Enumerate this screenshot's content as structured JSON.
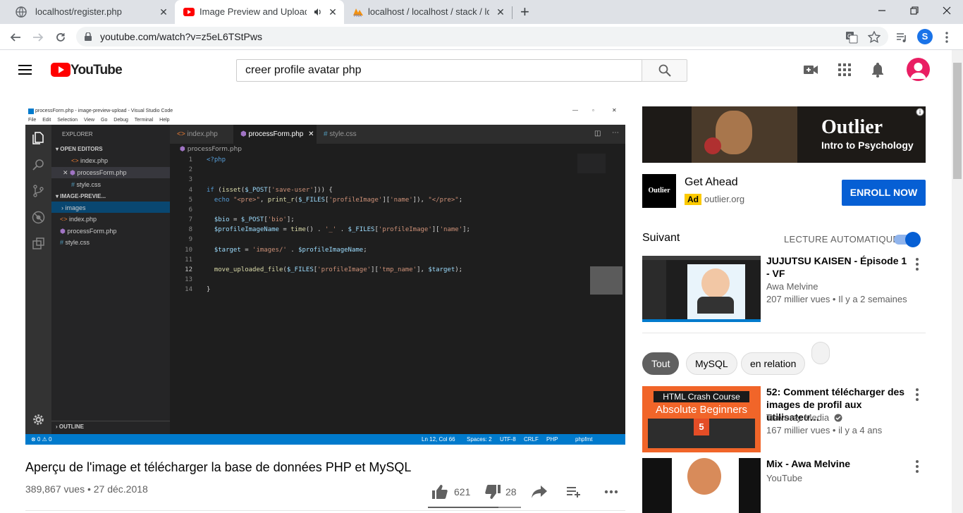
{
  "browser": {
    "tabs": [
      {
        "title": "localhost/register.php",
        "favicon": "globe-icon"
      },
      {
        "title": "Image Preview and Upload P",
        "favicon": "youtube-icon",
        "active": true,
        "audio": "speaker-icon"
      },
      {
        "title": "localhost / localhost / stack / log",
        "favicon": "phpmyadmin-icon"
      }
    ],
    "new_tab": "+",
    "url": "youtube.com/watch?v=z5eL6TStPws",
    "profile_initial": "S"
  },
  "youtube": {
    "logo_text": "YouTube",
    "search_value": "creer profile avatar php"
  },
  "player": {
    "vs_title": "processForm.php - image-preview-upload - Visual Studio Code",
    "vs_menu": [
      "File",
      "Edit",
      "Selection",
      "View",
      "Go",
      "Debug",
      "Terminal",
      "Help"
    ],
    "explorer_label": "EXPLORER",
    "open_editors_label": "OPEN EDITORS",
    "open_editors": [
      "index.php",
      "processForm.php",
      "style.css"
    ],
    "project_label": "IMAGE-PREVIE...",
    "project_items": [
      "images",
      "index.php",
      "processForm.php",
      "style.css"
    ],
    "outline_label": "OUTLINE",
    "editor_tabs": [
      "index.php",
      "processForm.php",
      "style.css"
    ],
    "breadcrumb": "processForm.php",
    "line_numbers": [
      "1",
      "2",
      "3",
      "4",
      "5",
      "6",
      "7",
      "8",
      "9",
      "10",
      "11",
      "12",
      "13",
      "14"
    ],
    "status_left": "⊗ 0 ⚠ 0",
    "status_items": [
      "Ln 12, Col 66",
      "Spaces: 2",
      "UTF-8",
      "CRLF",
      "PHP",
      "phpfmt"
    ]
  },
  "video": {
    "title": "Aperçu de l'image et télécharger la base de données PHP et MySQL",
    "views_date": "389,867 vues • 27 déc.2018",
    "likes": "621",
    "dislikes": "28",
    "like_ratio": 0.76
  },
  "ad": {
    "banner_brand": "Outlier",
    "banner_sub": "Intro to Psychology",
    "logo_text": "Outlier",
    "title": "Get Ahead",
    "badge": "Ad",
    "domain": "outlier.org",
    "cta": "ENROLL NOW"
  },
  "sidebar": {
    "up_next": "Suivant",
    "autoplay_label": "LECTURE AUTOMATIQUE",
    "autoplay_on": true,
    "chips": [
      "Tout",
      "MySQL",
      "en relation"
    ],
    "videos": [
      {
        "title": "JUJUTSU KAISEN - Épisode 1 - VF",
        "channel": "Awa Melvine",
        "stats": "207 millier vues • Il y a 2 semaines"
      },
      {
        "title": "52: Comment télécharger des images de profil aux utilisateu…",
        "channel": "Traversy Media",
        "stats": "167 millier vues • il y a 4 ans",
        "thumb_line1": "HTML Crash Course",
        "thumb_line2": "Absolute Beginners"
      },
      {
        "title": "Mix - Awa Melvine",
        "channel": "YouTube",
        "stats": ""
      }
    ]
  },
  "colors": {
    "youtube_red": "#ff0000",
    "enroll_blue": "#065fd4",
    "vscode_blue": "#007acc",
    "ad_yellow": "#fcca00"
  }
}
